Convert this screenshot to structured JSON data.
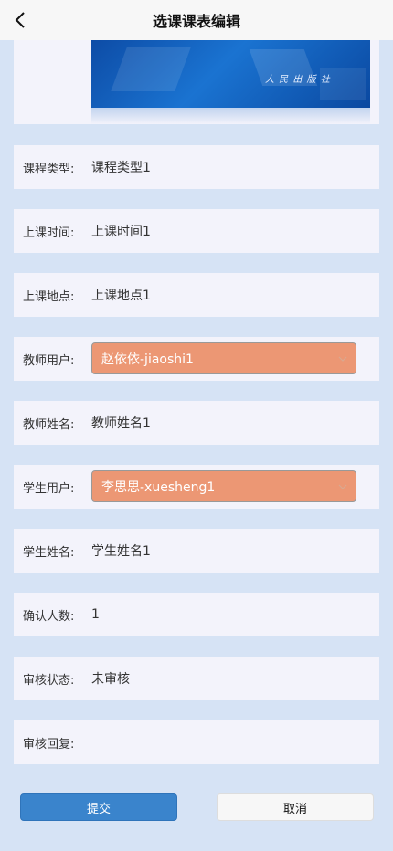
{
  "header": {
    "title": "选课课表编辑"
  },
  "image_card": {
    "watermark": "人 民 出 版 社"
  },
  "fields": [
    {
      "label": "课程类型:",
      "value": "课程类型1"
    },
    {
      "label": "上课时间:",
      "value": "上课时间1"
    },
    {
      "label": "上课地点:",
      "value": "上课地点1"
    },
    {
      "label": "教师用户:",
      "value": "赵依依-jiaoshi1"
    },
    {
      "label": "教师姓名:",
      "value": "教师姓名1"
    },
    {
      "label": "学生用户:",
      "value": "李思思-xuesheng1"
    },
    {
      "label": "学生姓名:",
      "value": "学生姓名1"
    },
    {
      "label": "确认人数:",
      "value": "1"
    },
    {
      "label": "审核状态:",
      "value": "未审核"
    },
    {
      "label": "审核回复:",
      "value": ""
    }
  ],
  "buttons": {
    "submit": "提交",
    "cancel": "取消"
  },
  "colors": {
    "page_bg": "#d6e3f5",
    "card_bg": "#f3f3fb",
    "select_bg": "#ec9774",
    "submit_bg": "#3a84cc"
  },
  "icons": {
    "back": "chevron-left-icon",
    "dropdown": "chevron-down-icon"
  }
}
